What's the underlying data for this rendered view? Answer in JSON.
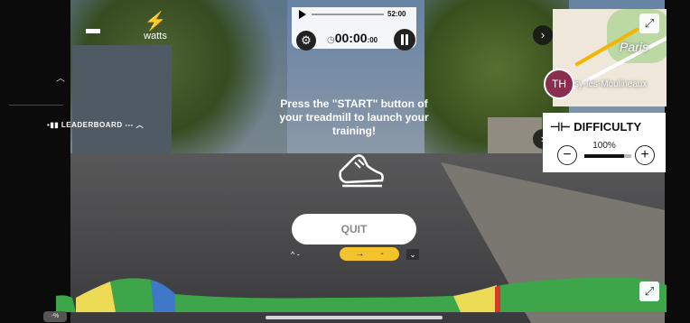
{
  "header": {
    "power_unit": "watts",
    "total_duration": "52:00",
    "elapsed_main": "00:00",
    "elapsed_fraction": ":00"
  },
  "leaderboard": {
    "label": "LEADERBOARD",
    "count": "---"
  },
  "message": {
    "text": "Press the \"START\" button of your treadmill to launch your training!"
  },
  "buttons": {
    "quit": "QUIT"
  },
  "speed": {
    "up_arrow": "^ -",
    "right_arrow": "→",
    "value": "-",
    "down_arrow": "⌄"
  },
  "map": {
    "city_label": "Paris",
    "town_label": "Issy-les-Moulineaux",
    "avatar_initials": "TH"
  },
  "difficulty": {
    "title": "DIFFICULTY",
    "percent": "100%",
    "level": 0.85
  },
  "bottom": {
    "percent_badge": "-%"
  },
  "colors": {
    "green": "#3ea64a",
    "yellow": "#eedb55",
    "blue": "#3f78c8",
    "red": "#d63a2a",
    "pill": "#f3c32b"
  }
}
